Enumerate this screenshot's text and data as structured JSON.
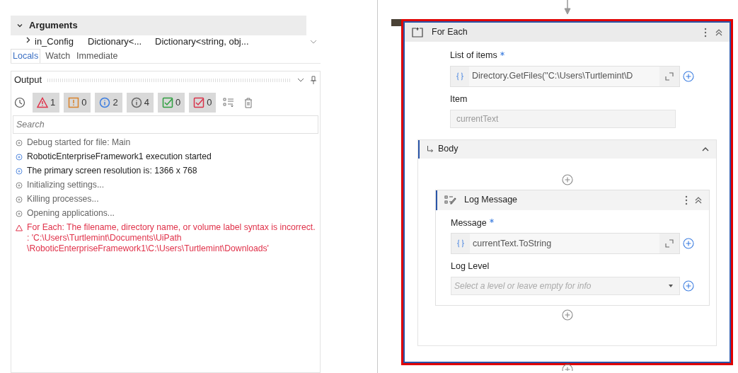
{
  "locals_panel": {
    "section": {
      "label": "Arguments",
      "expanded": true
    },
    "rows": [
      {
        "name": "in_Config",
        "type": "Dictionary<...",
        "value": "Dictionary<string, obj..."
      }
    ]
  },
  "debug_tabs": [
    {
      "label": "Locals",
      "selected": true
    },
    {
      "label": "Watch",
      "selected": false
    },
    {
      "label": "Immediate",
      "selected": false
    }
  ],
  "output": {
    "title": "Output",
    "filters": [
      {
        "kind": "error",
        "count": "1",
        "selected": true
      },
      {
        "kind": "warning",
        "count": "0",
        "selected": true
      },
      {
        "kind": "info",
        "count": "2",
        "selected": true
      },
      {
        "kind": "trace",
        "count": "4",
        "selected": true
      },
      {
        "kind": "success",
        "count": "0",
        "selected": true
      },
      {
        "kind": "failure",
        "count": "0",
        "selected": true
      }
    ],
    "search": {
      "placeholder": "Search"
    },
    "entries": [
      {
        "kind": "trace",
        "text": "Debug started for file: Main"
      },
      {
        "kind": "info",
        "text": "RoboticEnterpriseFramework1 execution started"
      },
      {
        "kind": "info",
        "text": "The primary screen resolution is: 1366 x 768"
      },
      {
        "kind": "trace",
        "text": "Initializing settings..."
      },
      {
        "kind": "trace",
        "text": "Killing processes..."
      },
      {
        "kind": "trace",
        "text": "Opening applications..."
      },
      {
        "kind": "error",
        "text": "For Each: The filename, directory name, or volume label syntax is incorrect. : 'C:\\Users\\Turtlemint\\Documents\\UiPath \\RoboticEnterpriseFramework1\\C:\\Users\\Turtlemint\\Downloads'"
      }
    ]
  },
  "for_each": {
    "title": "For Each",
    "selected": true,
    "fields": [
      {
        "kind": "expression",
        "label": "List of items",
        "required": true,
        "value": "Directory.GetFiles(\"C:\\Users\\Turtlemint\\D"
      },
      {
        "kind": "plain",
        "label": "Item",
        "required": false,
        "value": "currentText"
      }
    ],
    "body": {
      "label": "Body",
      "expanded": true,
      "activities": [
        {
          "title": "Log Message",
          "fields": [
            {
              "kind": "expression",
              "label": "Message",
              "required": true,
              "value": "currentText.ToString"
            },
            {
              "kind": "dropdown",
              "label": "Log Level",
              "required": false,
              "placeholder": "Select a level or leave empty for info"
            }
          ]
        }
      ]
    }
  }
}
